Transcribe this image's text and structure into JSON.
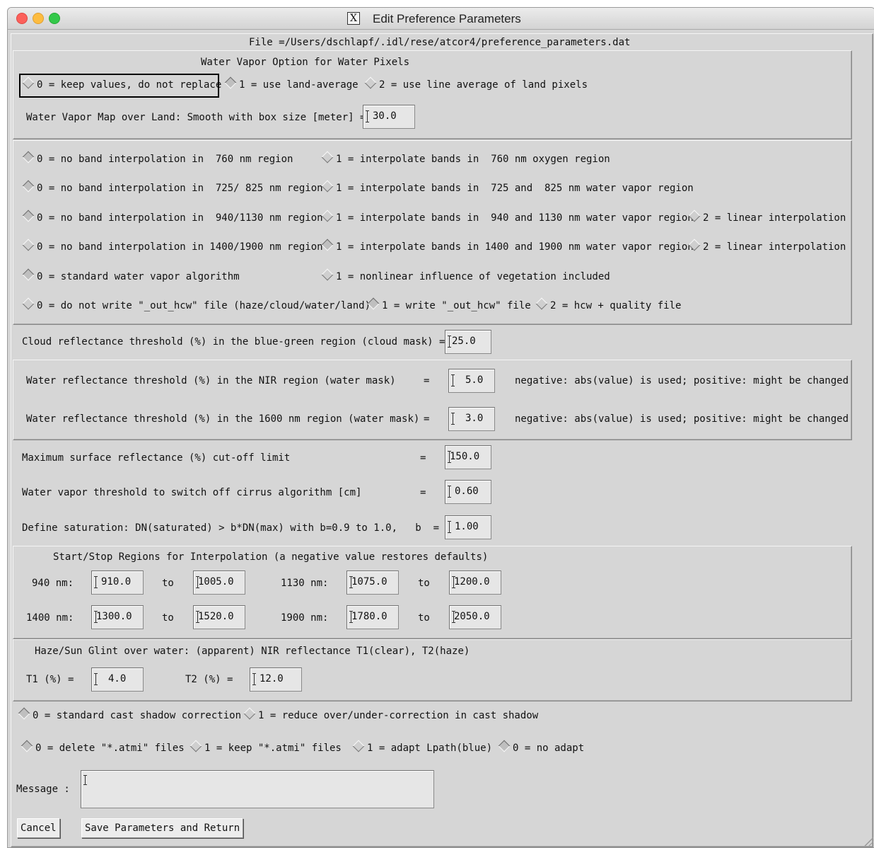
{
  "window": {
    "title": "Edit Preference Parameters",
    "x_icon": "x11-icon"
  },
  "file_label": "File =/Users/dschlapf/.idl/rese/atcor4/preference_parameters.dat",
  "water_vapor": {
    "heading": "Water Vapor Option for Water Pixels",
    "options": [
      "0 = keep values, do not replace",
      "1 = use land-average",
      "2 = use line average of land pixels"
    ],
    "smooth_label": "Water Vapor Map over Land: Smooth with box size [meter] =",
    "smooth_value": "30.0"
  },
  "interp": {
    "r760": {
      "opt0": "0 = no band interpolation in  760 nm region",
      "opt1": "1 = interpolate bands in  760 nm oxygen region"
    },
    "r725": {
      "opt0": "0 = no band interpolation in  725/ 825 nm region",
      "opt1": "1 = interpolate bands in  725 and  825 nm water vapor region"
    },
    "r940": {
      "opt0": "0 = no band interpolation in  940/1130 nm region",
      "opt1": "1 = interpolate bands in  940 and 1130 nm water vapor region",
      "opt2": "2 = linear interpolation"
    },
    "r1400": {
      "opt0": "0 = no band interpolation in 1400/1900 nm region",
      "opt1": "1 = interpolate bands in 1400 and 1900 nm water vapor region",
      "opt2": "2 = linear interpolation"
    },
    "wv_alg": {
      "opt0": "0 = standard water vapor algorithm",
      "opt1": "1 = nonlinear influence of vegetation included"
    },
    "hcw": {
      "opt0": "0 = do not write \"_out_hcw\" file (haze/cloud/water/land)",
      "opt1": "1 = write \"_out_hcw\" file",
      "opt2": "2 = hcw + quality file"
    }
  },
  "cloud": {
    "label": "Cloud reflectance threshold (%) in the blue-green region (cloud mask) =",
    "value": "25.0"
  },
  "water_refl": {
    "nir_label": "Water reflectance threshold (%) in the NIR region (water mask)",
    "nir_eq": "=",
    "nir_value": "5.0",
    "nir_note": "negative: abs(value) is used; positive: might be changed",
    "r1600_label": "Water reflectance threshold (%) in the 1600 nm region (water mask)",
    "r1600_eq": "=",
    "r1600_value": "3.0",
    "r1600_note": "negative: abs(value) is used; positive: might be changed"
  },
  "limits": {
    "max_label": "Maximum surface reflectance (%) cut-off limit",
    "max_eq": "=",
    "max_value": "150.0",
    "wv_label": "Water vapor threshold to switch off cirrus algorithm [cm]",
    "wv_eq": "=",
    "wv_value": "0.60",
    "sat_label": "Define saturation: DN(saturated) > b*DN(max) with b=0.9 to 1.0,   b  =",
    "sat_value": "1.00"
  },
  "startstop": {
    "heading": "Start/Stop Regions for Interpolation (a negative value restores defaults)",
    "l940": "940 nm:",
    "v940a": "910.0",
    "to1": "to",
    "v940b": "1005.0",
    "l1130": "1130 nm:",
    "v1130a": "1075.0",
    "to2": "to",
    "v1130b": "1200.0",
    "l1400": "1400 nm:",
    "v1400a": "1300.0",
    "to3": "to",
    "v1400b": "1520.0",
    "l1900": "1900 nm:",
    "v1900a": "1780.0",
    "to4": "to",
    "v1900b": "2050.0"
  },
  "haze": {
    "heading": "Haze/Sun Glint over water: (apparent) NIR reflectance T1(clear), T2(haze)",
    "t1_label": "T1 (%) =",
    "t1_value": "4.0",
    "t2_label": "T2 (%) =",
    "t2_value": "12.0"
  },
  "shadow": {
    "opt0": "0 = standard cast shadow correction",
    "opt1": "1 = reduce over/under-correction in cast shadow"
  },
  "atmi": {
    "opt0": "0 = delete \"*.atmi\" files",
    "opt1": "1 = keep \"*.atmi\" files",
    "adapt1": "1 = adapt Lpath(blue)",
    "adapt0": "0 = no adapt"
  },
  "message": {
    "label": "Message :",
    "value": ""
  },
  "buttons": {
    "cancel": "Cancel",
    "save": "Save Parameters and Return"
  }
}
